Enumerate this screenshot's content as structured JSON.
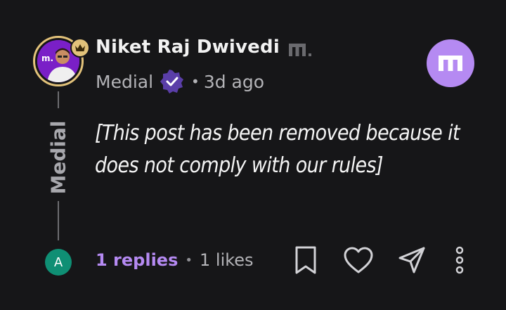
{
  "post": {
    "author": "Niket Raj Dwivedi",
    "organization": "Medial",
    "separator": "•",
    "time": "3d ago",
    "rail_label": "Medial",
    "body": "[This post has been removed because it does not comply with our rules]"
  },
  "footer": {
    "replies": "1 replies",
    "separator": "•",
    "likes": "1 likes",
    "user_initial": "A"
  },
  "colors": {
    "background": "#161618",
    "accent": "#b58af2",
    "verified": "#5a3ea8",
    "crown": "#e2c27a",
    "avatar_small": "#0f8f74"
  },
  "icons": [
    "crown-icon",
    "brand-m-icon",
    "verified-icon",
    "medial-logo-icon",
    "bookmark-icon",
    "heart-icon",
    "send-icon",
    "more-vertical-icon"
  ]
}
